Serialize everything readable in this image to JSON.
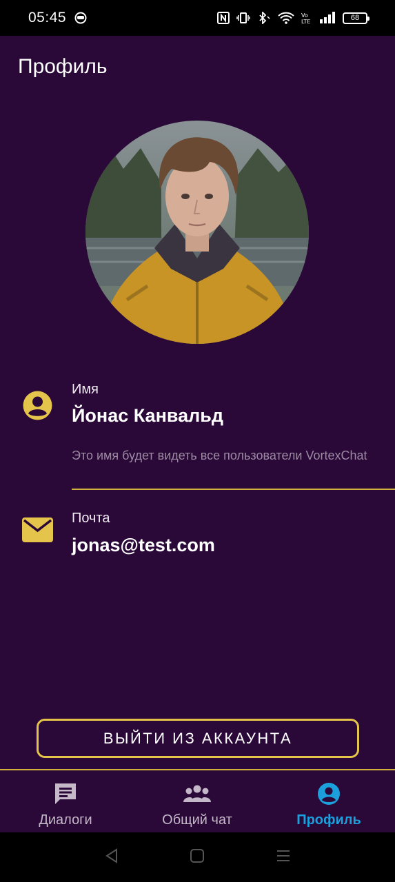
{
  "status_bar": {
    "time": "05:45",
    "battery": "68"
  },
  "page": {
    "title": "Профиль"
  },
  "profile": {
    "name_label": "Имя",
    "name_value": "Йонас Канвальд",
    "name_hint": "Это имя будет видеть все пользователи VortexChat",
    "email_label": "Почта",
    "email_value": "jonas@test.com"
  },
  "actions": {
    "logout_label": "ВЫЙТИ ИЗ АККАУНТА"
  },
  "bottom_nav": {
    "items": [
      {
        "label": "Диалоги",
        "icon": "chat-icon",
        "active": false
      },
      {
        "label": "Общий чат",
        "icon": "group-icon",
        "active": false
      },
      {
        "label": "Профиль",
        "icon": "account-circle-icon",
        "active": true
      }
    ]
  },
  "colors": {
    "background": "#2a0837",
    "accent_yellow": "#e4c44a",
    "active_blue": "#1ba0dc"
  }
}
